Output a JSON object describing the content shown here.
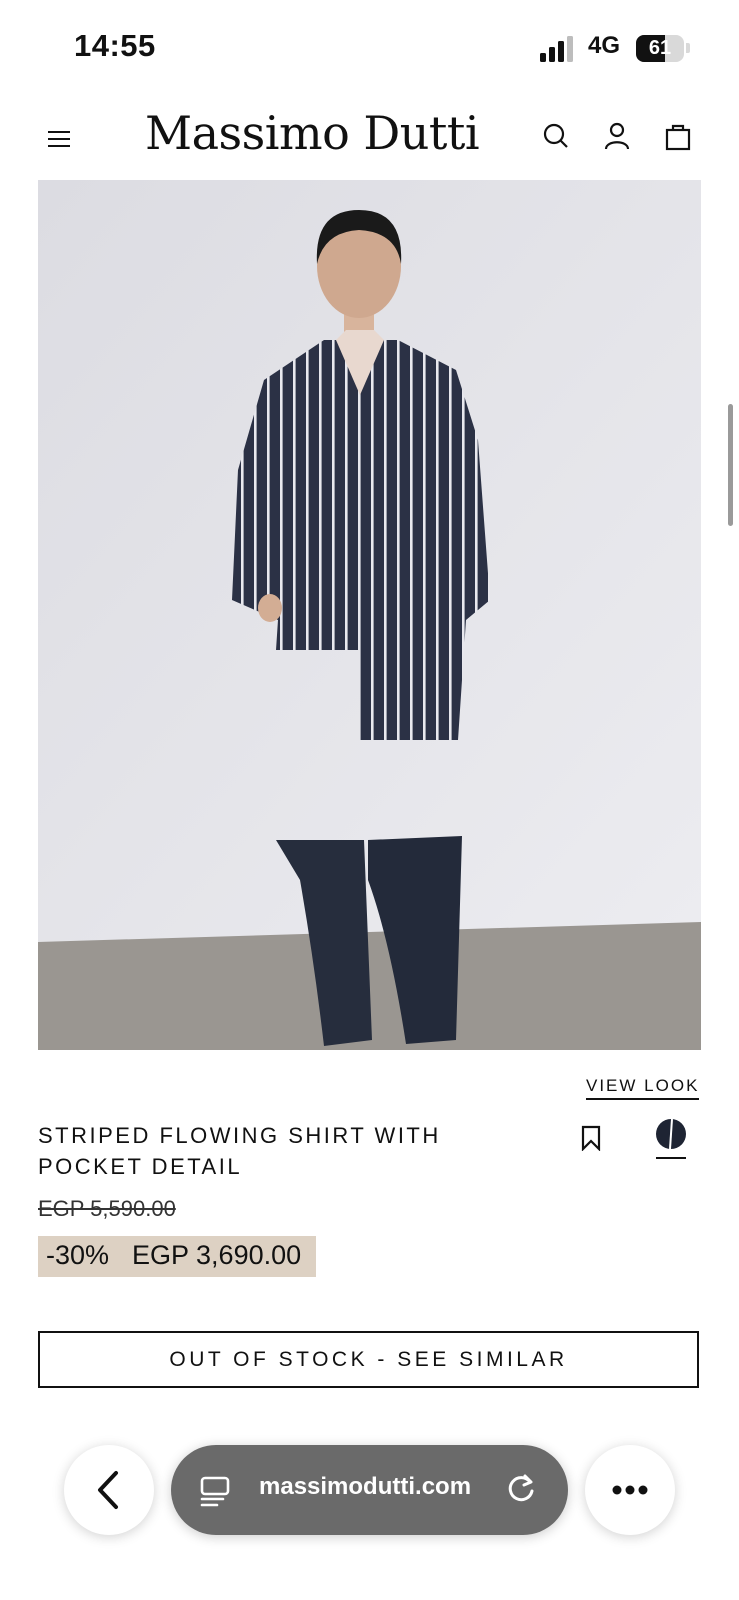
{
  "status_bar": {
    "time": "14:55",
    "network": "4G",
    "battery": "61",
    "battery_level": 0.61
  },
  "header": {
    "brand": "Massimo Dutti",
    "icons": [
      "menu-icon",
      "search-icon",
      "account-icon",
      "bag-icon"
    ]
  },
  "product": {
    "view_look": "VIEW LOOK",
    "title": "STRIPED FLOWING SHIRT WITH POCKET DETAIL",
    "original_price": "EGP 5,590.00",
    "discount": "-30%",
    "sale_price": "EGP 3,690.00",
    "out_of_stock_label": "OUT OF STOCK - SEE SIMILAR",
    "swatch_color": "#1e2433"
  },
  "browser": {
    "url": "massimodutti.com",
    "icons": [
      "back-arrow-icon",
      "tabs-icon",
      "reload-icon",
      "more-icon"
    ]
  },
  "colors": {
    "sale_background": "#ddd1c3",
    "text": "#111111",
    "url_pill": "#6a6a6a"
  }
}
